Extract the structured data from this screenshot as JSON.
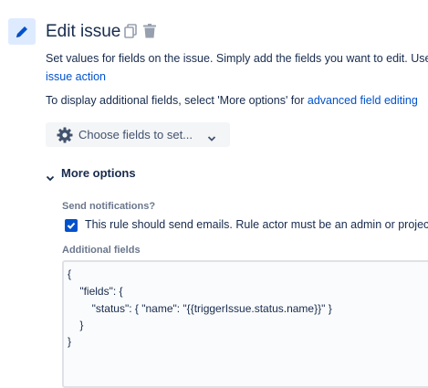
{
  "header": {
    "title": "Edit issue",
    "action_icon": "pencil-icon",
    "copy_icon": "copy-icon",
    "delete_icon": "trash-icon"
  },
  "description": {
    "line1": "Set values for fields on the issue. Simply add the fields you want to edit. Use 'Edit' to update fields with",
    "line2_link": "issue action",
    "line3_prefix": "To display additional fields, select 'More options' for ",
    "line3_link": "advanced field editing"
  },
  "choose_button": {
    "icon": "gear-icon",
    "label": "Choose fields to set...",
    "chevron": "chevron-down-icon"
  },
  "more_options": {
    "label": "More options",
    "chevron": "chevron-down-icon"
  },
  "notifications": {
    "label": "Send notifications?",
    "checked": true,
    "checkbox_label": "This rule should send emails. Rule actor must be an admin or project admin"
  },
  "additional_fields": {
    "label": "Additional fields",
    "code_lines": [
      "{",
      "    \"fields\": {",
      "        \"status\": { \"name\": \"{{triggerIssue.status.name}}\" }",
      "    }",
      "}"
    ]
  },
  "colors": {
    "accent": "#0052cc",
    "icon_bg": "#deebff",
    "text": "#172b4d",
    "muted": "#6b778c"
  }
}
